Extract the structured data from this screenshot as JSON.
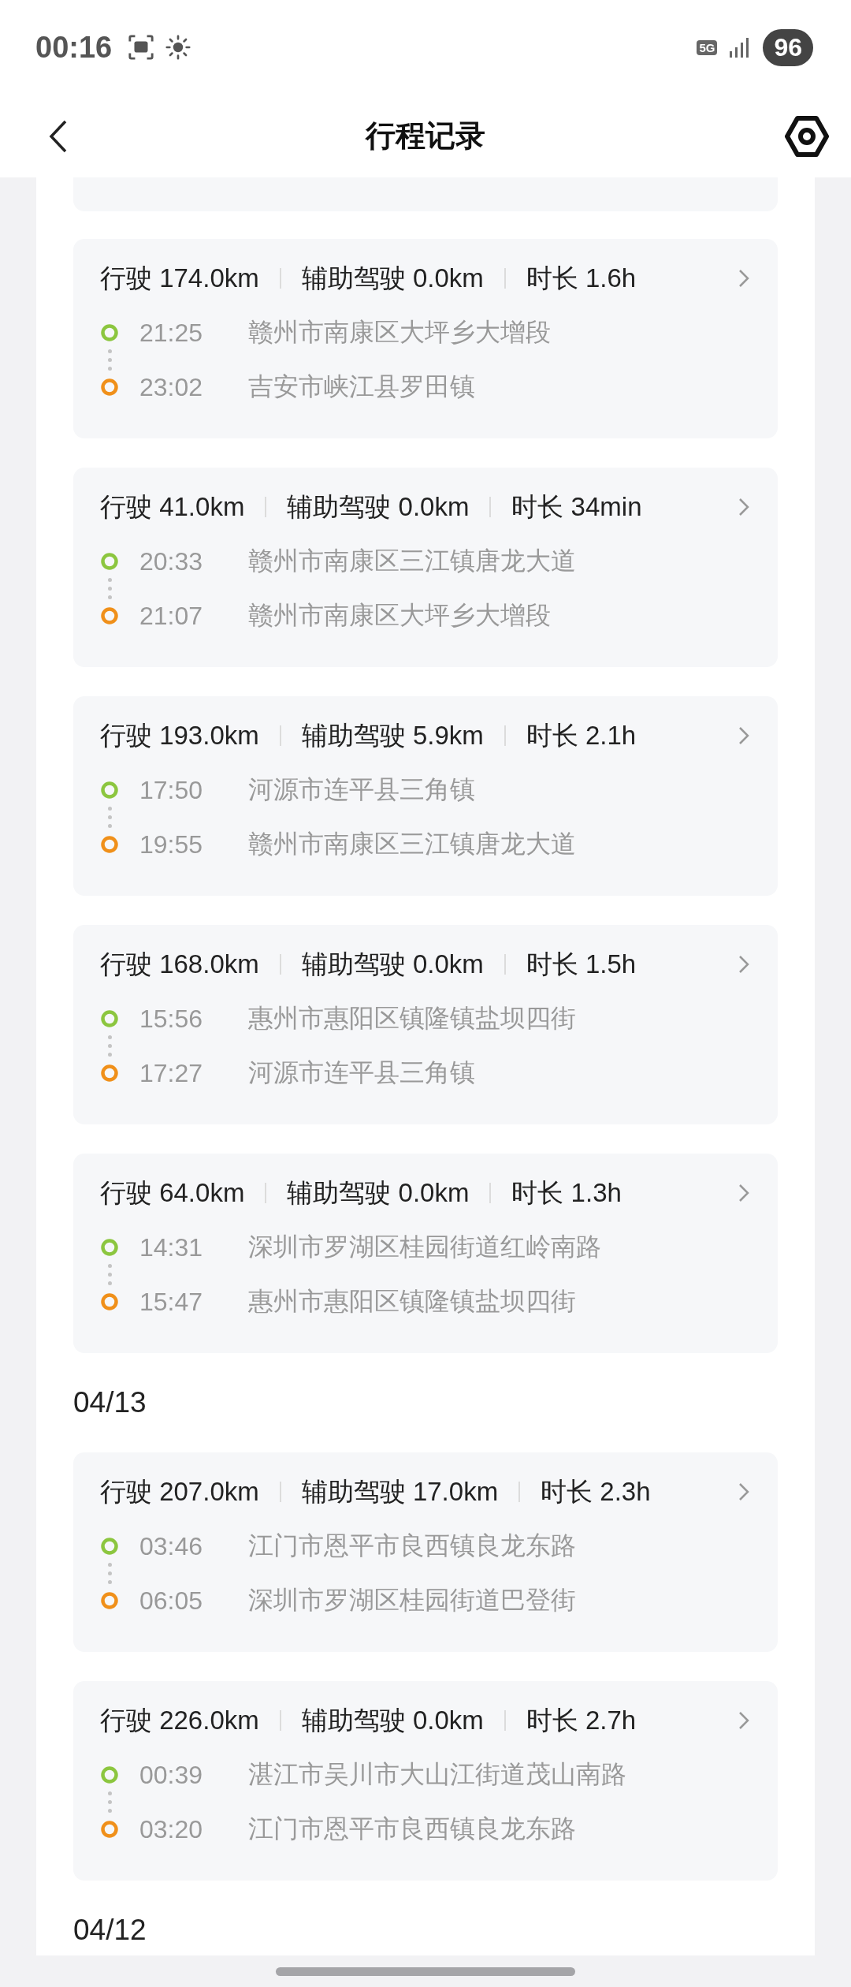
{
  "status_bar": {
    "time": "00:16",
    "network": "5G",
    "battery": "96"
  },
  "header": {
    "title": "行程记录"
  },
  "groups": [
    {
      "trips": [
        {
          "distance": "行驶 174.0km",
          "assist": "辅助驾驶 0.0km",
          "duration": "时长 1.6h",
          "start": {
            "time": "21:25",
            "place": "赣州市南康区大坪乡大增段"
          },
          "end": {
            "time": "23:02",
            "place": "吉安市峡江县罗田镇"
          }
        },
        {
          "distance": "行驶 41.0km",
          "assist": "辅助驾驶 0.0km",
          "duration": "时长 34min",
          "start": {
            "time": "20:33",
            "place": "赣州市南康区三江镇唐龙大道"
          },
          "end": {
            "time": "21:07",
            "place": "赣州市南康区大坪乡大增段"
          }
        },
        {
          "distance": "行驶 193.0km",
          "assist": "辅助驾驶 5.9km",
          "duration": "时长 2.1h",
          "start": {
            "time": "17:50",
            "place": "河源市连平县三角镇"
          },
          "end": {
            "time": "19:55",
            "place": "赣州市南康区三江镇唐龙大道"
          }
        },
        {
          "distance": "行驶 168.0km",
          "assist": "辅助驾驶 0.0km",
          "duration": "时长 1.5h",
          "start": {
            "time": "15:56",
            "place": "惠州市惠阳区镇隆镇盐坝四街"
          },
          "end": {
            "time": "17:27",
            "place": "河源市连平县三角镇"
          }
        },
        {
          "distance": "行驶 64.0km",
          "assist": "辅助驾驶 0.0km",
          "duration": "时长 1.3h",
          "start": {
            "time": "14:31",
            "place": "深圳市罗湖区桂园街道红岭南路"
          },
          "end": {
            "time": "15:47",
            "place": "惠州市惠阳区镇隆镇盐坝四街"
          }
        }
      ]
    },
    {
      "date": "04/13",
      "trips": [
        {
          "distance": "行驶 207.0km",
          "assist": "辅助驾驶 17.0km",
          "duration": "时长 2.3h",
          "start": {
            "time": "03:46",
            "place": "江门市恩平市良西镇良龙东路"
          },
          "end": {
            "time": "06:05",
            "place": "深圳市罗湖区桂园街道巴登街"
          }
        },
        {
          "distance": "行驶 226.0km",
          "assist": "辅助驾驶 0.0km",
          "duration": "时长 2.7h",
          "start": {
            "time": "00:39",
            "place": "湛江市吴川市大山江街道茂山南路"
          },
          "end": {
            "time": "03:20",
            "place": "江门市恩平市良西镇良龙东路"
          }
        }
      ]
    },
    {
      "date": "04/12"
    }
  ]
}
